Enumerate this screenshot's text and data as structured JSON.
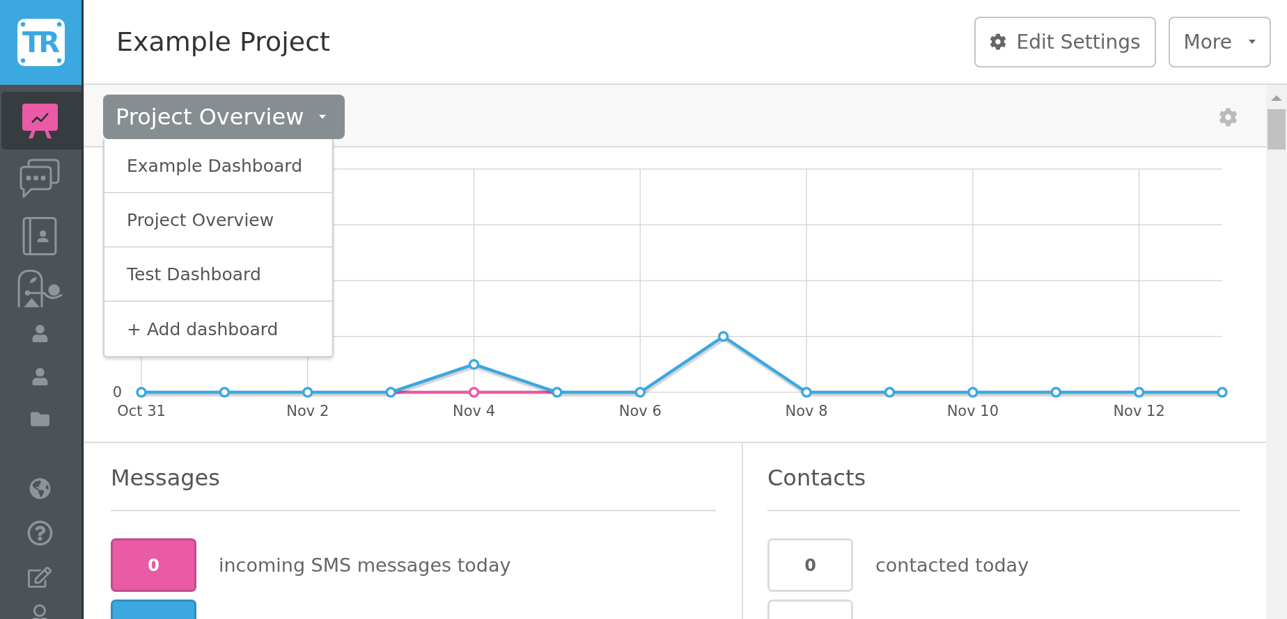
{
  "sidebar": {
    "logo": {
      "text": "TR"
    },
    "items": [
      {
        "kind": "dashboard",
        "selected": true
      },
      {
        "kind": "messages",
        "selected": false
      },
      {
        "kind": "contacts",
        "selected": false
      },
      {
        "kind": "presenter",
        "selected": false
      },
      {
        "kind": "person",
        "selected": false
      },
      {
        "kind": "person",
        "selected": false
      },
      {
        "kind": "folder",
        "selected": false
      }
    ],
    "footer_items": [
      {
        "kind": "globe",
        "selected": false
      },
      {
        "kind": "help",
        "selected": false
      },
      {
        "kind": "edit",
        "selected": false
      },
      {
        "kind": "user",
        "selected": false
      }
    ]
  },
  "header": {
    "title": "Example Project",
    "buttons": [
      {
        "kind": "settings",
        "label": "Edit Settings"
      },
      {
        "kind": "dropdown",
        "label": "More"
      }
    ]
  },
  "toolbar": {
    "dashboard_select": {
      "label": "Project Overview",
      "expanded": true
    },
    "menu_items": [
      {
        "label": "Example Dashboard"
      },
      {
        "label": "Project Overview"
      },
      {
        "label": "Test Dashboard"
      },
      {
        "label": "+ Add dashboard"
      }
    ]
  },
  "chart": {
    "y_tick_label": "0",
    "x_tick_labels": [
      "Oct 31",
      "Nov 2",
      "Nov 4",
      "Nov 6",
      "Nov 8",
      "Nov 10",
      "Nov 12"
    ]
  },
  "panels": [
    {
      "title": "Messages",
      "stats": [
        {
          "kind": "filled",
          "color": "#e95ba6",
          "value": "0",
          "label": "incoming SMS messages today"
        },
        {
          "kind": "filled",
          "color": "#3ba8e0"
        }
      ]
    },
    {
      "title": "Contacts",
      "stats": [
        {
          "kind": "outline",
          "value": "0",
          "label": "contacted today"
        },
        {
          "kind": "outline"
        }
      ]
    }
  ]
}
